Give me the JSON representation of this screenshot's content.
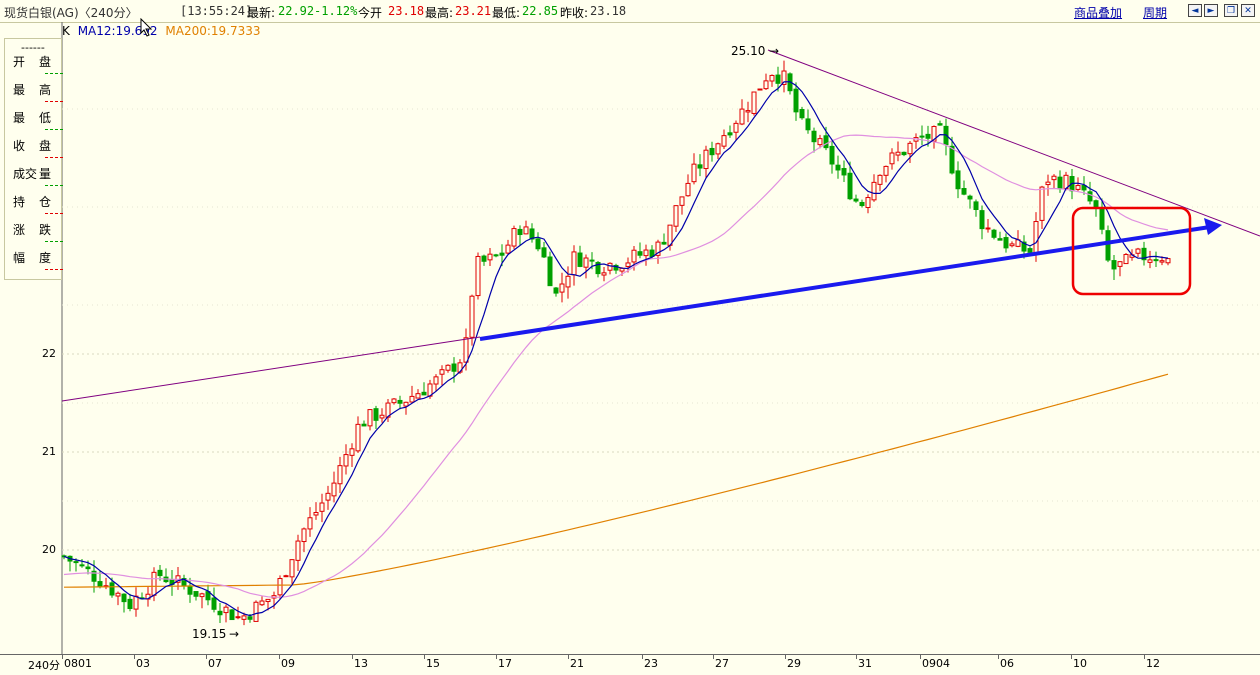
{
  "header": {
    "title": "现货白银(AG)〈240分〉",
    "time": "[13:55:24]",
    "last_label": "最新:",
    "last_value": "22.92",
    "change_pct": "-1.12%",
    "open_label": "今开",
    "open_value": "23.18",
    "high_label": "最高:",
    "high_value": "23.21",
    "low_label": "最低:",
    "low_value": "22.85",
    "prev_label": "昨收:",
    "prev_value": "23.18",
    "overlay_label": "商品叠加",
    "period_label": "周期"
  },
  "legend": {
    "k_label": "K",
    "ma12": "MA12:19.6",
    "ma12_tail": "92",
    "ma200": "MA200:19.7333",
    "colors": {
      "ma12": "#0000AA",
      "ma60": "#E090E0",
      "ma200": "#E08000",
      "up": "#E00000",
      "down": "#00A000",
      "trend": "#800080",
      "arrow": "#1A1AEE",
      "box": "#EE0000"
    }
  },
  "panel": {
    "dash": "------",
    "rows": [
      {
        "a": "开",
        "b": "盘"
      },
      {
        "a": "最",
        "b": "高"
      },
      {
        "a": "最",
        "b": "低"
      },
      {
        "a": "收",
        "b": "盘"
      },
      {
        "a": "成交",
        "b": "量"
      },
      {
        "a": "持",
        "b": "仓"
      },
      {
        "a": "涨",
        "b": "跌"
      },
      {
        "a": "幅",
        "b": "度"
      }
    ]
  },
  "annotations": {
    "high_mark": "25.10",
    "low_mark": "19.15"
  },
  "xaxis": {
    "period": "240分",
    "ticks": [
      "0801",
      "03",
      "07",
      "09",
      "13",
      "15",
      "17",
      "21",
      "23",
      "27",
      "29",
      "31",
      "0904",
      "06",
      "10",
      "12"
    ]
  },
  "chart_data": {
    "type": "candlestick",
    "y_ticks": [
      20,
      21,
      22
    ],
    "ylim": [
      19.0,
      25.3
    ],
    "high": 25.1,
    "low": 19.15
  }
}
